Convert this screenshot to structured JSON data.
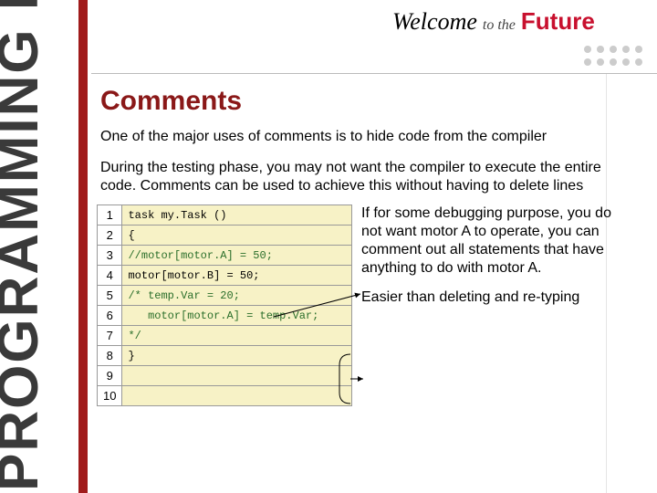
{
  "side_title": "PROGRAMMING RULES",
  "welcome": {
    "word": "Welcome",
    "to": "to the",
    "future": "Future"
  },
  "slide_title": "Comments",
  "para1": "One of the major uses of comments is to hide code from the compiler",
  "para2": "During the testing phase, you may not want the compiler to execute the entire code. Comments can be used to achieve this without having to delete lines",
  "code": {
    "rows": [
      {
        "n": "1",
        "t": "task my.Task ()",
        "c": false
      },
      {
        "n": "2",
        "t": "{",
        "c": false
      },
      {
        "n": "3",
        "t": "//motor[motor.A] = 50;",
        "c": true
      },
      {
        "n": "4",
        "t": "motor[motor.B] = 50;",
        "c": false
      },
      {
        "n": "5",
        "t": "/* temp.Var = 20;",
        "c": true
      },
      {
        "n": "6",
        "t": "   motor[motor.A] = temp.Var;",
        "c": true
      },
      {
        "n": "7",
        "t": "*/",
        "c": true
      },
      {
        "n": "8",
        "t": "}",
        "c": false
      },
      {
        "n": "9",
        "t": "",
        "c": false
      },
      {
        "n": "10",
        "t": "",
        "c": false
      }
    ]
  },
  "annotation1": "If for some debugging purpose, you do not want motor A to operate, you can comment out all statements that have anything to do with motor A.",
  "annotation2": "Easier than deleting and re-typing"
}
